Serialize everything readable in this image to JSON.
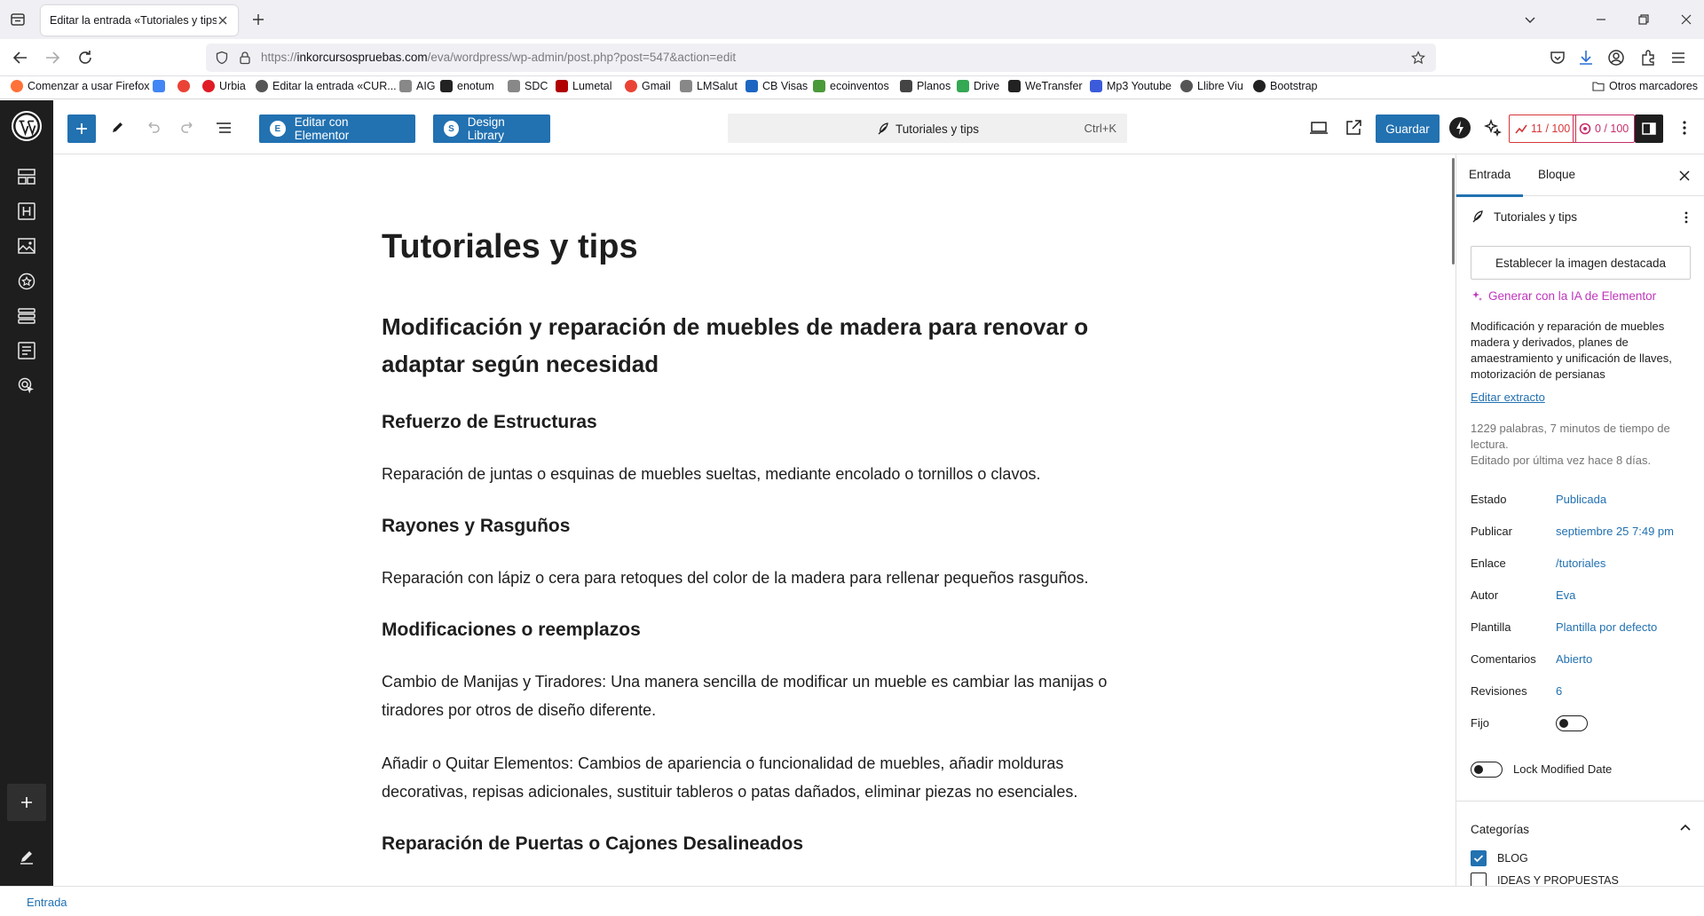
{
  "browser": {
    "tab_title": "Editar la entrada «Tutoriales y tips»",
    "url_prefix": "https://",
    "url_host": "inkorcursospruebas.com",
    "url_path": "/eva/wordpress/wp-admin/post.php?post=547&action=edit",
    "bookmarks": [
      {
        "label": "Comenzar a usar Firefox",
        "color": "#ff7139"
      },
      {
        "label": "",
        "color": "#4285f4"
      },
      {
        "label": "",
        "color": "#ea4335"
      },
      {
        "label": "Urbia",
        "color": "#e01b24"
      },
      {
        "label": "Editar la entrada «CUR...",
        "color": "#555555"
      },
      {
        "label": "AIG",
        "color": "#888888"
      },
      {
        "label": "enotum",
        "color": "#222222"
      },
      {
        "label": "SDC",
        "color": "#888888"
      },
      {
        "label": "Lumetal",
        "color": "#b00000"
      },
      {
        "label": "Gmail",
        "color": "#ea4335"
      },
      {
        "label": "LMSalut",
        "color": "#888888"
      },
      {
        "label": "CB Visas",
        "color": "#1c66c2"
      },
      {
        "label": "ecoinventos",
        "color": "#4a9a3a"
      },
      {
        "label": "Planos",
        "color": "#444444"
      },
      {
        "label": "Drive",
        "color": "#34a853"
      },
      {
        "label": "WeTransfer",
        "color": "#222222"
      },
      {
        "label": "Mp3 Youtube",
        "color": "#3b5bdb"
      },
      {
        "label": "Llibre Viu",
        "color": "#555555"
      },
      {
        "label": "Bootstrap",
        "color": "#222222"
      }
    ],
    "other_bookmarks": "Otros marcadores"
  },
  "toolbar": {
    "edit_elementor": "Editar con Elementor",
    "design_library": "Design Library",
    "doc_title": "Tutoriales y tips",
    "shortcut": "Ctrl+K",
    "save": "Guardar",
    "seo_score": "11 / 100",
    "readability_score": "0 / 100"
  },
  "post": {
    "title": "Tutoriales y tips",
    "blocks": [
      {
        "type": "h2",
        "text": "Modificación y reparación de muebles de madera para renovar o adaptar según necesidad"
      },
      {
        "type": "h3",
        "text": "Refuerzo de Estructuras"
      },
      {
        "type": "p",
        "text": "Reparación de juntas o esquinas de muebles sueltas, mediante encolado o tornillos o clavos."
      },
      {
        "type": "h3",
        "text": "Rayones y Rasguños"
      },
      {
        "type": "p",
        "text": "Reparación con lápiz o cera para retoques del color de la madera para rellenar pequeños rasguños."
      },
      {
        "type": "h3",
        "text": "Modificaciones o reemplazos"
      },
      {
        "type": "p",
        "text": "Cambio de Manijas y Tiradores: Una manera sencilla de modificar un mueble es cambiar las manijas o tiradores por otros de diseño diferente."
      },
      {
        "type": "p",
        "text": "Añadir o Quitar Elementos: Cambios de apariencia o funcionalidad de muebles, añadir molduras decorativas, repisas adicionales, sustituir tableros o patas dañados, eliminar piezas no esenciales."
      },
      {
        "type": "h3",
        "text": "Reparación de Puertas o Cajones Desalineados"
      }
    ]
  },
  "settings": {
    "tab_post": "Entrada",
    "tab_block": "Bloque",
    "panel_title": "Tutoriales y tips",
    "featured_image": "Establecer la imagen destacada",
    "ai_link": "Generar con la IA de Elementor",
    "excerpt": "Modificación y reparación de muebles madera y derivados, planes de amaestramiento y unificación de llaves, motorización de persianas",
    "edit_excerpt": "Editar extracto",
    "word_info": "1229 palabras, 7 minutos de tiempo de lectura.",
    "edited_info": "Editado por última vez hace 8 días.",
    "rows": [
      {
        "label": "Estado",
        "value": "Publicada"
      },
      {
        "label": "Publicar",
        "value": "septiembre 25 7:49 pm"
      },
      {
        "label": "Enlace",
        "value": "/tutoriales"
      },
      {
        "label": "Autor",
        "value": "Eva"
      },
      {
        "label": "Plantilla",
        "value": "Plantilla por defecto"
      },
      {
        "label": "Comentarios",
        "value": "Abierto"
      },
      {
        "label": "Revisiones",
        "value": "6"
      }
    ],
    "sticky_label": "Fijo",
    "lock_label": "Lock Modified Date",
    "categories_title": "Categorías",
    "categories": [
      {
        "label": "BLOG",
        "checked": true
      },
      {
        "label": "IDEAS Y PROPUESTAS",
        "checked": false
      }
    ]
  },
  "footer": {
    "breadcrumb": "Entrada"
  }
}
